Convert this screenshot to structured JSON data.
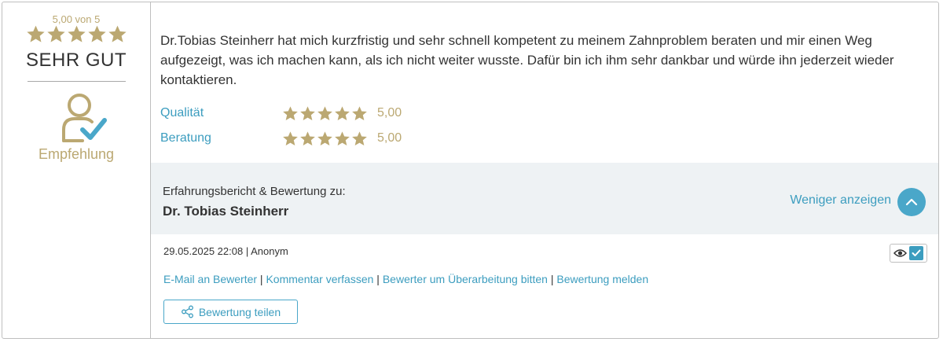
{
  "rating": {
    "score_text": "5,00 von 5",
    "stars": 5,
    "verdict": "SEHR GUT",
    "recommendation_label": "Empfehlung",
    "star_color": "#bba872"
  },
  "review": {
    "text": "Dr.Tobias Steinherr hat mich kurzfristig und sehr schnell kompetent zu meinem Zahnproblem beraten und mir einen Weg aufgezeigt, was ich machen kann, als ich nicht weiter wusste. Dafür bin ich ihm sehr dankbar und würde ihn jederzeit wieder kontaktieren.",
    "criteria": [
      {
        "label": "Qualität",
        "stars": 5,
        "value": "5,00"
      },
      {
        "label": "Beratung",
        "stars": 5,
        "value": "5,00"
      }
    ]
  },
  "panel": {
    "subtitle": "Erfahrungsbericht & Bewertung zu:",
    "doctor_name": "Dr. Tobias Steinherr",
    "toggle_label": "Weniger anzeigen"
  },
  "meta": {
    "date": "29.05.2025 22:08",
    "separator": " | ",
    "author": "Anonym"
  },
  "links": {
    "email": "E-Mail an Bewerter",
    "comment": "Kommentar verfassen",
    "revise": "Bewerter um Überarbeitung bitten",
    "report": "Bewertung melden",
    "separator": " | "
  },
  "share": {
    "label": "Bewertung teilen"
  },
  "colors": {
    "accent": "#3c9dbf",
    "gold": "#bba872",
    "panel_bg": "#eef2f4"
  }
}
